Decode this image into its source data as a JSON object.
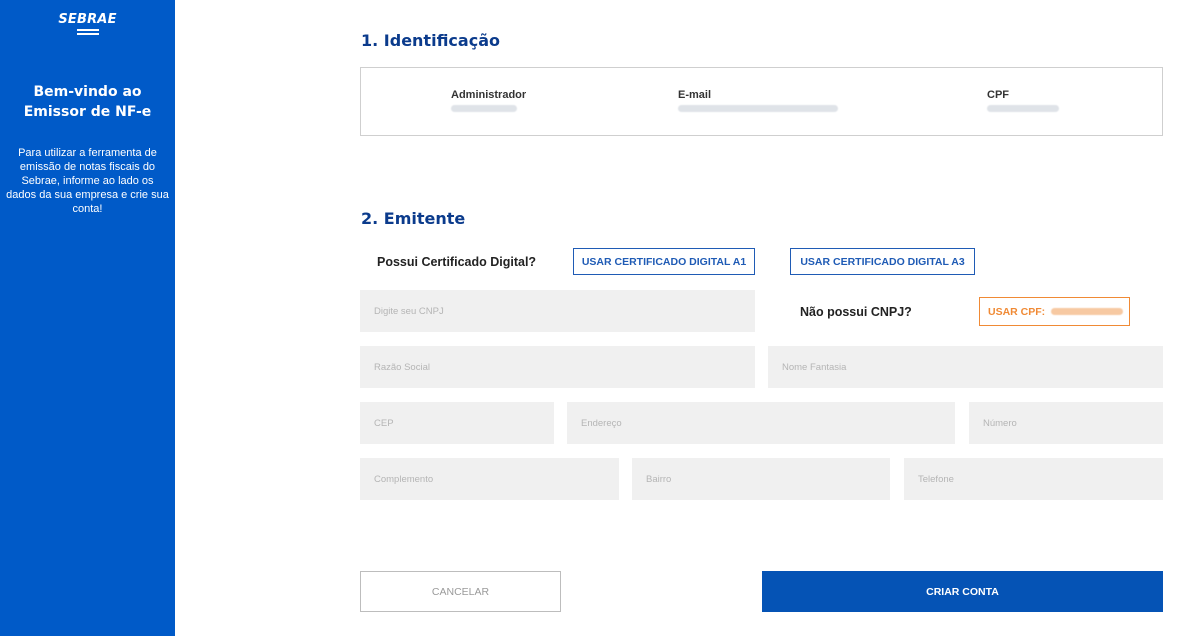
{
  "sidebar": {
    "logo_text": "SEBRAE",
    "welcome_title": "Bem-vindo ao Emissor de NF-e",
    "description": "Para utilizar a ferramenta de emissão de notas fiscais do Sebrae, informe ao lado os dados da sua empresa e crie sua conta!",
    "background_color": "#005ac8"
  },
  "identification": {
    "title": "1. Identificação",
    "columns": [
      {
        "label": "Administrador",
        "value_blurred": true
      },
      {
        "label": "E-mail",
        "value_blurred": true
      },
      {
        "label": "CPF",
        "value_blurred": true
      }
    ]
  },
  "issuer": {
    "title": "2. Emitente",
    "certificate_question": "Possui Certificado Digital?",
    "cert_a1_button": "USAR CERTIFICADO DIGITAL A1",
    "cert_a3_button": "USAR CERTIFICADO DIGITAL A3",
    "no_cnpj_question": "Não possui CNPJ?",
    "use_cpf_button": "USAR CPF:",
    "fields": {
      "cnpj": "Digite seu CNPJ",
      "razao_social": "Razão Social",
      "nome_fantasia": "Nome Fantasia",
      "cep": "CEP",
      "endereco": "Endereço",
      "numero": "Número",
      "complemento": "Complemento",
      "bairro": "Bairro",
      "telefone": "Telefone"
    }
  },
  "actions": {
    "cancel": "CANCELAR",
    "create": "CRIAR CONTA"
  },
  "colors": {
    "primary": "#005ac8",
    "title": "#0b3b8c",
    "accent_orange": "#f08a35",
    "field_bg": "#f0f0f0"
  }
}
